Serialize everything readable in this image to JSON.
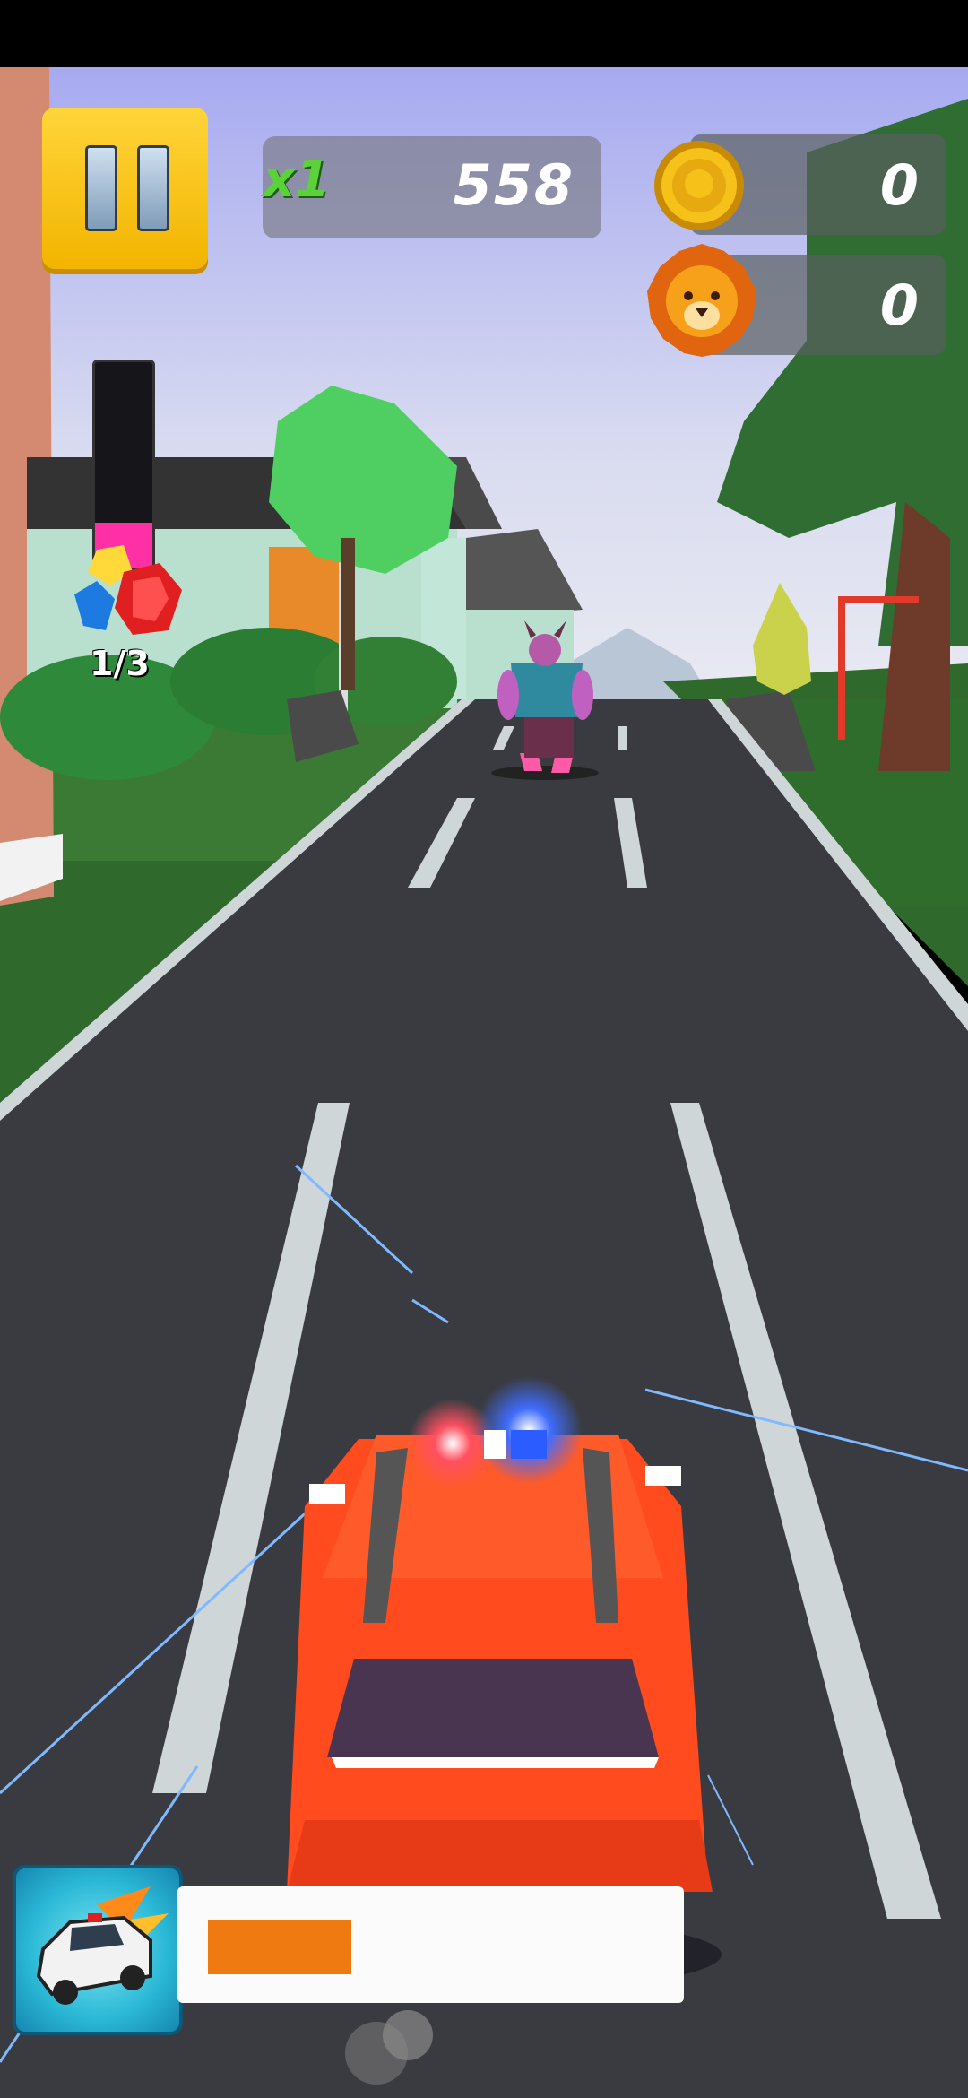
{
  "hud": {
    "multiplier": "x1",
    "score": "558",
    "coins": "0",
    "lion_tokens": "0",
    "gem_progress": "1/3",
    "power_meter_level": 0.22,
    "boost_level": 0.32
  },
  "icons": {
    "pause": "pause-icon",
    "coin": "lion-coin-icon",
    "lion": "lion-face-icon",
    "gems": "gems-icon",
    "vehicle": "police-car-icon"
  },
  "colors": {
    "pause_button": "#f5bc00",
    "multiplier": "#5bd13a",
    "power_fill": "#ff2fa6",
    "boost_fill": "#f07a12",
    "player_car": "#ff4b1e",
    "road": "#3a3b40"
  }
}
